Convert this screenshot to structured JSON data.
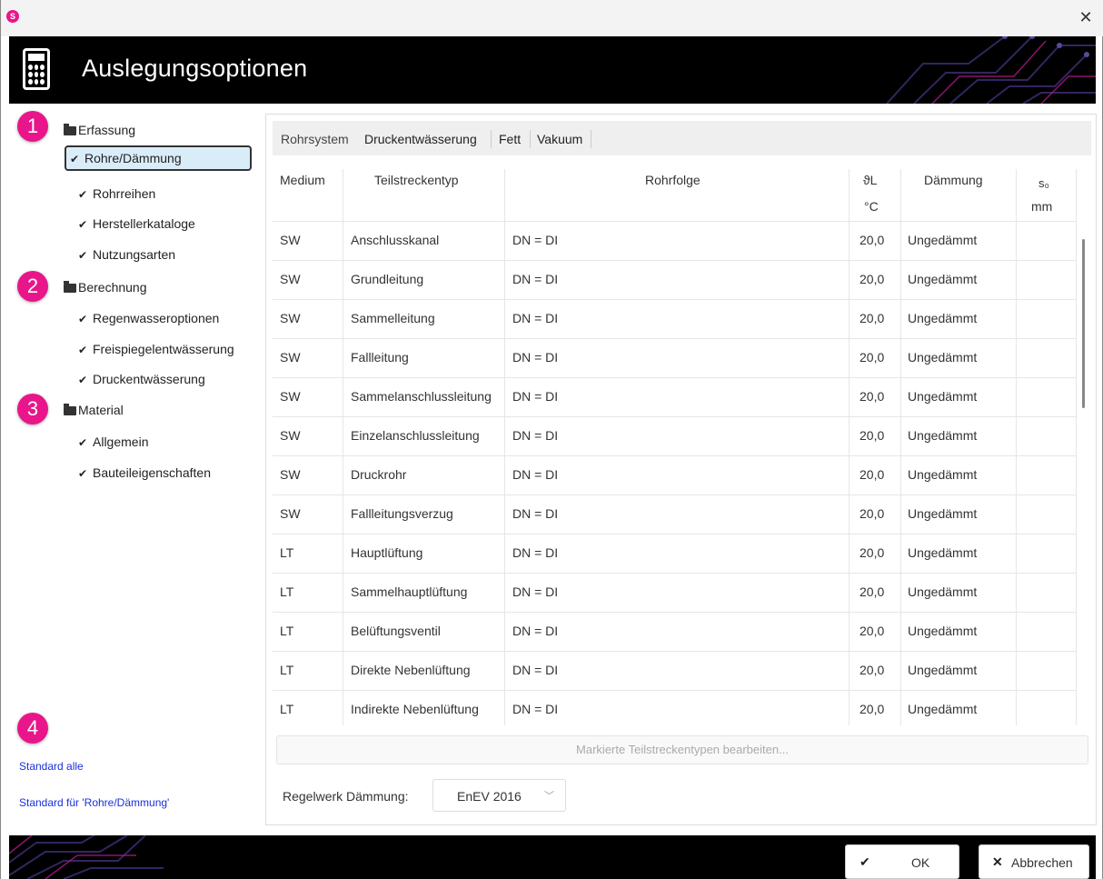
{
  "window": {
    "app_logo_glyph": "S",
    "close_glyph": "✕"
  },
  "header": {
    "title": "Auslegungsoptionen",
    "icon": "calculator-icon"
  },
  "nav": {
    "badges": [
      "1",
      "2",
      "3",
      "4"
    ],
    "groups": [
      {
        "label": "Erfassung",
        "items": [
          "Rohre/Dämmung",
          "Rohrreihen",
          "Herstellerkataloge",
          "Nutzungsarten"
        ]
      },
      {
        "label": "Berechnung",
        "items": [
          "Regenwasseroptionen",
          "Freispiegelentwässerung",
          "Druckentwässerung"
        ]
      },
      {
        "label": "Material",
        "items": [
          "Allgemein",
          "Bauteileigenschaften"
        ]
      }
    ],
    "selected": "Rohre/Dämmung",
    "links": [
      "Standard alle",
      "Standard für 'Rohre/Dämmung'"
    ]
  },
  "tabs": [
    "Rohrsystem",
    "Druckentwässerung",
    "Fett",
    "Vakuum"
  ],
  "table": {
    "headers": {
      "medium": "Medium",
      "teilstreckentyp": "Teilstreckentyp",
      "rohrfolge": "Rohrfolge",
      "temp_symbol": "ϑL",
      "temp_unit": "°C",
      "daemmung": "Dämmung",
      "s0_symbol": "s₀",
      "s0_unit": "mm"
    },
    "rows": [
      [
        "SW",
        "Anschlusskanal",
        "DN = DI",
        "20,0",
        "Ungedämmt",
        ""
      ],
      [
        "SW",
        "Grundleitung",
        "DN = DI",
        "20,0",
        "Ungedämmt",
        ""
      ],
      [
        "SW",
        "Sammelleitung",
        "DN = DI",
        "20,0",
        "Ungedämmt",
        ""
      ],
      [
        "SW",
        "Fallleitung",
        "DN = DI",
        "20,0",
        "Ungedämmt",
        ""
      ],
      [
        "SW",
        "Sammelanschlussleitung",
        "DN = DI",
        "20,0",
        "Ungedämmt",
        ""
      ],
      [
        "SW",
        "Einzelanschlussleitung",
        "DN = DI",
        "20,0",
        "Ungedämmt",
        ""
      ],
      [
        "SW",
        "Druckrohr",
        "DN = DI",
        "20,0",
        "Ungedämmt",
        ""
      ],
      [
        "SW",
        "Fallleitungsverzug",
        "DN = DI",
        "20,0",
        "Ungedämmt",
        ""
      ],
      [
        "LT",
        "Hauptlüftung",
        "DN = DI",
        "20,0",
        "Ungedämmt",
        ""
      ],
      [
        "LT",
        "Sammelhauptlüftung",
        "DN = DI",
        "20,0",
        "Ungedämmt",
        ""
      ],
      [
        "LT",
        "Belüftungsventil",
        "DN = DI",
        "20,0",
        "Ungedämmt",
        ""
      ],
      [
        "LT",
        "Direkte Nebenlüftung",
        "DN = DI",
        "20,0",
        "Ungedämmt",
        ""
      ],
      [
        "LT",
        "Indirekte Nebenlüftung",
        "DN = DI",
        "20,0",
        "Ungedämmt",
        ""
      ]
    ]
  },
  "edit_button": "Markierte Teilstreckentypen bearbeiten...",
  "regelwerk": {
    "label": "Regelwerk Dämmung:",
    "value": "EnEV 2016"
  },
  "footer": {
    "ok_label": "OK",
    "ok_icon": "checkmark-icon",
    "cancel_label": "Abbrechen",
    "cancel_icon": "x-icon"
  },
  "colors": {
    "badge": "#e8168a",
    "link": "#1a2fd9",
    "selected_bg": "#d9edf9",
    "header_bg": "#000000"
  }
}
